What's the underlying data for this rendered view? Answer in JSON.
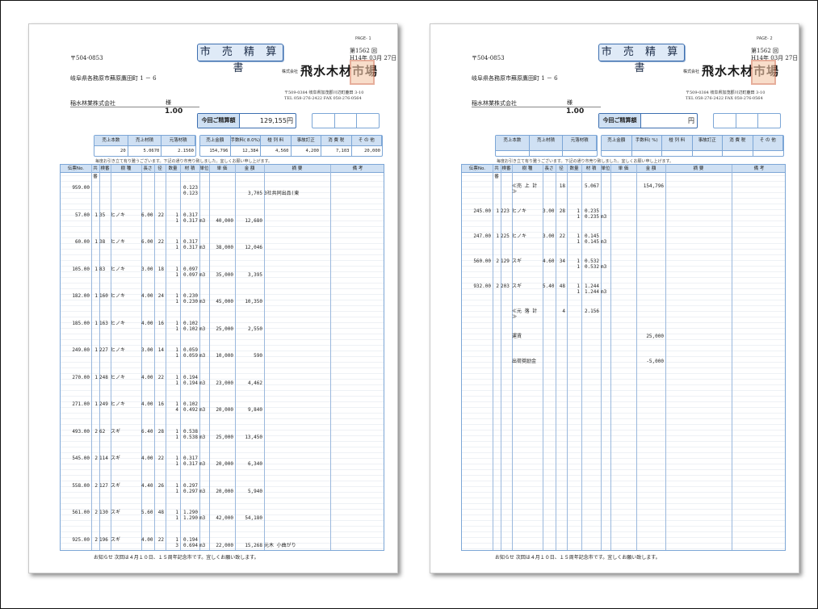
{
  "pages": [
    {
      "page_no": "PAGE- 1",
      "title": "市 売 精 算 書",
      "doc_no": "第1562 回",
      "date": "H14年 03月 27日",
      "zip": "〒504-0853",
      "address": "岐阜県各務原市蘇原鷹田町 1 － 6",
      "customer": "稲水林業株式会社",
      "honorific": "様",
      "customer_num": "1.00",
      "company_prefix": "株式会社",
      "company": "飛水木材市場",
      "company_zip_addr": "〒509-0384 岐阜県加茂郡川辺町鹿田 3-10",
      "company_tel": "TEL 058-276-2422  FAX 058-276-0564",
      "amount_label": "今回ご精算額",
      "amount": "129,155円",
      "summary_a_headers": [
        "売上本数",
        "売上材積",
        "元落材積"
      ],
      "summary_a_values": [
        "20",
        "5.0670",
        "2.1560"
      ],
      "summary_b_headers": [
        "売上金額",
        "手数料( 8.0%)",
        "椪 列 料",
        "事故訂正",
        "消 費 税",
        "そ の 他"
      ],
      "summary_b_values": [
        "154,796",
        "12,384",
        "4,560",
        "4,200",
        "7,103",
        "20,000"
      ],
      "note": "毎度お引き立て有り難うございます。下記の通り市売り致しました。宜しくお願い申し上げます。",
      "grid_headers": [
        "伝票No.",
        "共番",
        "検番",
        "樹 種",
        "長さ",
        "径",
        "数量",
        "材 積",
        "単位",
        "単 価",
        "金 額",
        "摘 要",
        "備 考"
      ],
      "rows": [
        {
          "no": "959.00",
          "a": "",
          "b": "",
          "sp": "",
          "len": "",
          "dia": "",
          "qty": "",
          "qty2": "",
          "v1": "0.123",
          "v2": "0.123",
          "u": "",
          "price": "",
          "amt": "3,705",
          "memo": "3社共同出品(東"
        },
        {
          "no": "57.00",
          "a": "1",
          "b": "35",
          "sp": "ヒノキ",
          "len": "6.00",
          "dia": "22",
          "qty": "1",
          "qty2": "1",
          "v1": "0.317",
          "v2": "0.317",
          "u": "m3",
          "price": "40,000",
          "amt": "12,680",
          "memo": ""
        },
        {
          "no": "60.00",
          "a": "1",
          "b": "38",
          "sp": "ヒノキ",
          "len": "6.00",
          "dia": "22",
          "qty": "1",
          "qty2": "1",
          "v1": "0.317",
          "v2": "0.317",
          "u": "m3",
          "price": "38,000",
          "amt": "12,046",
          "memo": ""
        },
        {
          "no": "105.00",
          "a": "1",
          "b": "83",
          "sp": "ヒノキ",
          "len": "3.00",
          "dia": "18",
          "qty": "1",
          "qty2": "1",
          "v1": "0.097",
          "v2": "0.097",
          "u": "m3",
          "price": "35,000",
          "amt": "3,395",
          "memo": ""
        },
        {
          "no": "182.00",
          "a": "1",
          "b": "160",
          "sp": "ヒノキ",
          "len": "4.00",
          "dia": "24",
          "qty": "1",
          "qty2": "1",
          "v1": "0.230",
          "v2": "0.230",
          "u": "m3",
          "price": "45,000",
          "amt": "10,350",
          "memo": ""
        },
        {
          "no": "185.00",
          "a": "1",
          "b": "163",
          "sp": "ヒノキ",
          "len": "4.00",
          "dia": "16",
          "qty": "1",
          "qty2": "1",
          "v1": "0.102",
          "v2": "0.102",
          "u": "m3",
          "price": "25,000",
          "amt": "2,550",
          "memo": ""
        },
        {
          "no": "249.00",
          "a": "1",
          "b": "227",
          "sp": "ヒノキ",
          "len": "3.00",
          "dia": "14",
          "qty": "1",
          "qty2": "1",
          "v1": "0.059",
          "v2": "0.059",
          "u": "m3",
          "price": "10,000",
          "amt": "590",
          "memo": ""
        },
        {
          "no": "270.00",
          "a": "1",
          "b": "248",
          "sp": "ヒノキ",
          "len": "4.00",
          "dia": "22",
          "qty": "1",
          "qty2": "1",
          "v1": "0.194",
          "v2": "0.194",
          "u": "m3",
          "price": "23,000",
          "amt": "4,462",
          "memo": ""
        },
        {
          "no": "271.00",
          "a": "1",
          "b": "249",
          "sp": "ヒノキ",
          "len": "4.00",
          "dia": "16",
          "qty": "1",
          "qty2": "4",
          "v1": "0.102",
          "v2": "0.492",
          "u": "m3",
          "price": "20,000",
          "amt": "9,840",
          "memo": ""
        },
        {
          "no": "493.00",
          "a": "2",
          "b": "62",
          "sp": "スギ",
          "len": "6.40",
          "dia": "28",
          "qty": "1",
          "qty2": "1",
          "v1": "0.538",
          "v2": "0.538",
          "u": "m3",
          "price": "25,000",
          "amt": "13,450",
          "memo": ""
        },
        {
          "no": "545.00",
          "a": "2",
          "b": "114",
          "sp": "スギ",
          "len": "4.00",
          "dia": "22",
          "qty": "1",
          "qty2": "1",
          "v1": "0.317",
          "v2": "0.317",
          "u": "m3",
          "price": "20,000",
          "amt": "6,340",
          "memo": ""
        },
        {
          "no": "558.00",
          "a": "2",
          "b": "127",
          "sp": "スギ",
          "len": "4.40",
          "dia": "26",
          "qty": "1",
          "qty2": "1",
          "v1": "0.297",
          "v2": "0.297",
          "u": "m3",
          "price": "20,000",
          "amt": "5,940",
          "memo": ""
        },
        {
          "no": "561.00",
          "a": "2",
          "b": "130",
          "sp": "スギ",
          "len": "5.60",
          "dia": "48",
          "qty": "1",
          "qty2": "1",
          "v1": "1.290",
          "v2": "1.290",
          "u": "m3",
          "price": "42,000",
          "amt": "54,180",
          "memo": ""
        },
        {
          "no": "925.00",
          "a": "2",
          "b": "196",
          "sp": "スギ",
          "len": "4.00",
          "dia": "22",
          "qty": "1",
          "qty2": "3",
          "v1": "0.194",
          "v2": "0.694",
          "u": "m3",
          "price": "22,000",
          "amt": "15,268",
          "memo": "元木 小曲がり"
        }
      ],
      "footer": "お知らせ  次回は４月１０日、１５周年記念市です。宜しくお願い致します。"
    },
    {
      "page_no": "PAGE- 2",
      "title": "市 売 精 算 書",
      "doc_no": "第1562 回",
      "date": "H14年 03月 27日",
      "zip": "〒504-0853",
      "address": "岐阜県各務原市蘇原鷹田町 1 － 6",
      "customer": "稲水林業株式会社",
      "honorific": "様",
      "customer_num": "1.00",
      "company_prefix": "株式会社",
      "company": "飛水木材市場",
      "company_zip_addr": "〒509-0384 岐阜県加茂郡川辺町鹿田 3-10",
      "company_tel": "TEL 058-276-2422  FAX 058-276-0564",
      "amount_label": "今回ご精算額",
      "amount": "円",
      "summary_a_headers": [
        "売上本数",
        "売上材積",
        "元落材積"
      ],
      "summary_a_values": [
        "",
        "",
        ""
      ],
      "summary_b_headers": [
        "売上金額",
        "手数料(  %)",
        "椪 列 料",
        "事故訂正",
        "消 費 税",
        "そ の 他"
      ],
      "summary_b_values": [
        "",
        "",
        "",
        "",
        "",
        ""
      ],
      "note": "毎度お引き立て有り難うございます。下記の通り市売り致しました。宜しくお願い申し上げます。",
      "grid_headers": [
        "伝票No.",
        "共番",
        "検番",
        "樹 種",
        "長さ",
        "径",
        "数量",
        "材 積",
        "単位",
        "単 価",
        "金 額",
        "摘 要",
        "備 考"
      ],
      "rows": [
        {
          "no": "",
          "a": "",
          "b": "",
          "sp": "≪売 上 計≫",
          "len": "",
          "dia": "18",
          "qty": "",
          "qty2": "",
          "v1": "5.067",
          "v2": "",
          "u": "",
          "price": "",
          "amt": "154,796",
          "memo": ""
        },
        {
          "no": "245.00",
          "a": "1",
          "b": "223",
          "sp": "ヒノキ",
          "len": "3.00",
          "dia": "28",
          "qty": "1",
          "qty2": "1",
          "v1": "0.235",
          "v2": "0.235",
          "u": "m3",
          "price": "",
          "amt": "",
          "memo": ""
        },
        {
          "no": "247.00",
          "a": "1",
          "b": "225",
          "sp": "ヒノキ",
          "len": "3.00",
          "dia": "22",
          "qty": "1",
          "qty2": "1",
          "v1": "0.145",
          "v2": "0.145",
          "u": "m3",
          "price": "",
          "amt": "",
          "memo": ""
        },
        {
          "no": "560.00",
          "a": "2",
          "b": "129",
          "sp": "スギ",
          "len": "4.60",
          "dia": "34",
          "qty": "1",
          "qty2": "1",
          "v1": "0.532",
          "v2": "0.532",
          "u": "m3",
          "price": "",
          "amt": "",
          "memo": ""
        },
        {
          "no": "932.00",
          "a": "2",
          "b": "203",
          "sp": "スギ",
          "len": "5.40",
          "dia": "48",
          "qty": "1",
          "qty2": "1",
          "v1": "1.244",
          "v2": "1.244",
          "u": "m3",
          "price": "",
          "amt": "",
          "memo": ""
        },
        {
          "no": "",
          "a": "",
          "b": "",
          "sp": "≪元 落 計≫",
          "len": "",
          "dia": "4",
          "qty": "",
          "qty2": "",
          "v1": "2.156",
          "v2": "",
          "u": "",
          "price": "",
          "amt": "",
          "memo": ""
        },
        {
          "no": "",
          "a": "",
          "b": "",
          "sp": "運賃",
          "len": "",
          "dia": "",
          "qty": "",
          "qty2": "",
          "v1": "",
          "v2": "",
          "u": "",
          "price": "",
          "amt": "25,000",
          "memo": ""
        },
        {
          "no": "",
          "a": "",
          "b": "",
          "sp": "出荷奨励金",
          "len": "",
          "dia": "",
          "qty": "",
          "qty2": "",
          "v1": "",
          "v2": "",
          "u": "",
          "price": "",
          "amt": "-5,000",
          "memo": ""
        }
      ],
      "footer": "お知らせ  次回は４月１０日、１５周年記念市です。宜しくお願い致します。"
    }
  ]
}
